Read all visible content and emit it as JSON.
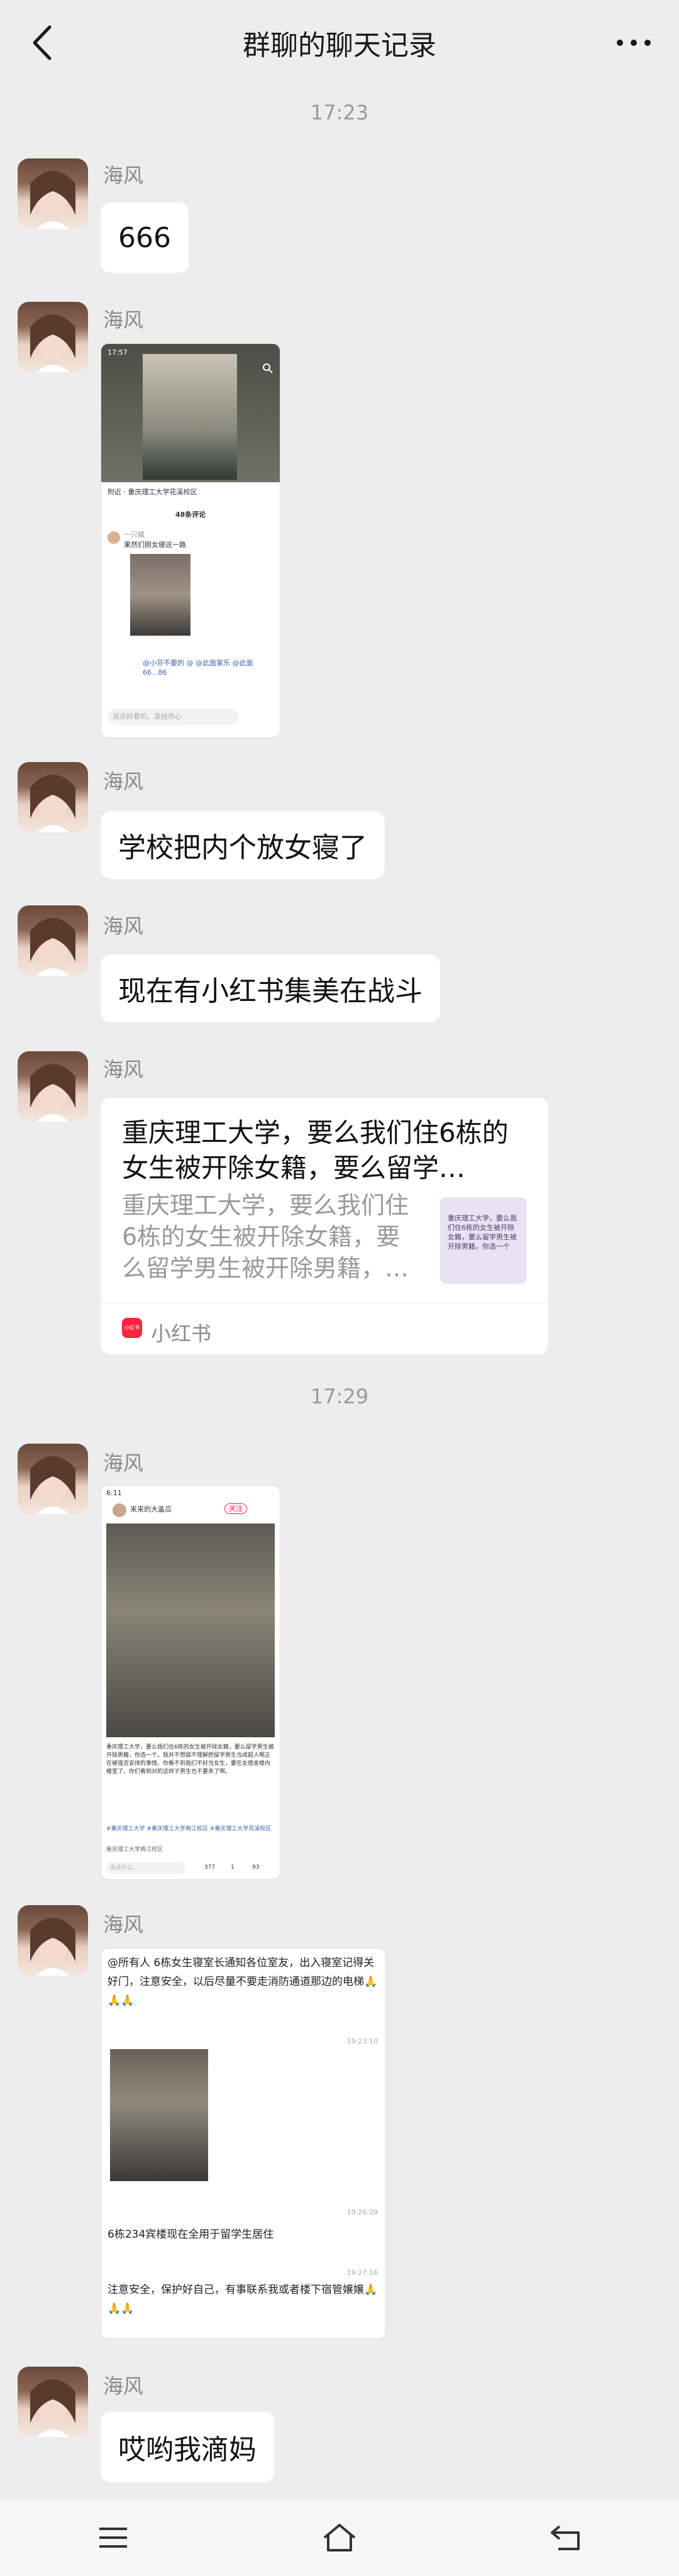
{
  "header": {
    "title": "群聊的聊天记录"
  },
  "times": [
    "17:23",
    "17:29"
  ],
  "sender": "海风",
  "messages": {
    "m1": "666",
    "m3": "学校把内个放女寝了",
    "m4": "现在有小红书集美在战斗",
    "m9": "哎哟我滴妈"
  },
  "link": {
    "title": "重庆理工大学，要么我们住6栋的女生被开除女籍，要么留学…",
    "desc": "重庆理工大学，要么我们住6栋的女生被开除女籍，要么留学男生被开除男籍，…",
    "thumb_text": "重庆理工大学，要么我们住6栋的女生被开除女籍，要么留学男生被开除男籍，你选一个",
    "source": "小红书",
    "source_badge": "小红书"
  },
  "shot1": {
    "status_time": "17:57",
    "location": "附近 · 重庆理工大学花溪校区",
    "comments_header": "48条评论",
    "comment_user": "一只橘",
    "comment_text": "果然们刚女寝这一路",
    "reply_text": "@小芬不要的 @ @此面家乐 @此面 66...86",
    "input_placeholder": "说点好看的，发给热心"
  },
  "shot2": {
    "status_time": "6:11",
    "author": "来来的大盖瓜",
    "follow": "关注",
    "body": "重庆理工大学，要么我们住6栋的女生被开除女籍，要么留学男生被开除男籍，你选一个。我并不想搞不理解把留学男生当成超人啊正在被强吉安排的事情。你看不到我们不好当女生，要在女宿舍楼内楼里了，你们看到对的这样子男生也不要来了啊。",
    "tags": "#重庆理工大学 #重庆理工大学两江校区 #重庆理工大学花溪校区",
    "location": "重庆理工大学两江校区",
    "input": "说点什么...",
    "likes": "377",
    "stars": "1",
    "comments": "93"
  },
  "shot3": {
    "notice1": "@所有人 6栋女生寝室长通知各位室友，出入寝室记得关好门，注意安全，以后尽量不要走消防通道那边的电梯🙏🙏🙏",
    "time1": "19:23:10",
    "time2": "19:26:29",
    "notice2": "6栋234宾楼现在全用于留学生居住",
    "time3": "19:27:16",
    "notice3": "注意安全，保护好自己，有事联系我或者楼下宿管嬢嬢🙏🙏🙏"
  },
  "colors": {
    "background": "#ededed",
    "bubble": "#ffffff",
    "xhs_red": "#ff2442"
  },
  "icons": [
    "back-arrow-icon",
    "more-dots-icon",
    "menu-icon",
    "home-icon",
    "return-icon"
  ]
}
